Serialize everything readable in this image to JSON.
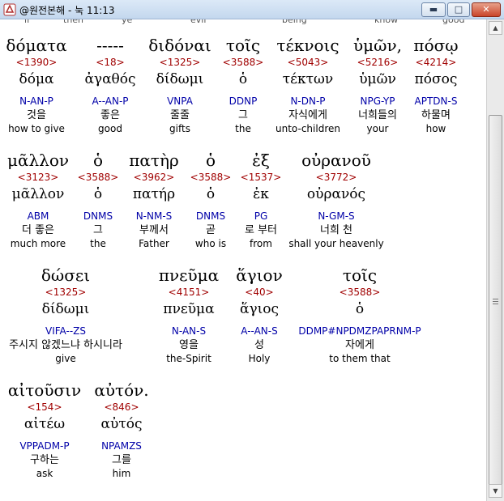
{
  "window": {
    "title": "@원전본해 - 눅 11:13"
  },
  "top_fragments": [
    "if",
    "then",
    "ye",
    "evil",
    "being",
    "know",
    "good"
  ],
  "lines": [
    [
      {
        "word": "δόματα",
        "strongs": "<1390>",
        "lemma": "δόμα",
        "parsing": "N-AN-P",
        "korean": "것을",
        "english": "how to give"
      },
      {
        "word": "-----",
        "strongs": "<18>",
        "lemma": "ἀγαθός",
        "parsing": "A--AN-P",
        "korean": "좋은",
        "english": "good"
      },
      {
        "word": "διδόναι",
        "strongs": "<1325>",
        "lemma": "δίδωμι",
        "parsing": "VNPA",
        "korean": "줄줄",
        "english": "gifts"
      },
      {
        "word": "τοῖς",
        "strongs": "<3588>",
        "lemma": "ὁ",
        "parsing": "DDNP",
        "korean": "그",
        "english": "the"
      },
      {
        "word": "τέκνοις",
        "strongs": "<5043>",
        "lemma": "τέκτων",
        "parsing": "N-DN-P",
        "korean": "자식에게",
        "english": "unto-children"
      },
      {
        "word": "ὑμῶν,",
        "strongs": "<5216>",
        "lemma": "ὑμῶν",
        "parsing": "NPG-YP",
        "korean": "너희들의",
        "english": "your"
      },
      {
        "word": "πόσῳ",
        "strongs": "<4214>",
        "lemma": "πόσος",
        "parsing": "APTDN-S",
        "korean": "하물며",
        "english": "how"
      }
    ],
    [
      {
        "word": "μᾶλλον",
        "strongs": "<3123>",
        "lemma": "μᾶλλον",
        "parsing": "ABM",
        "korean": "더 좋은",
        "english": "much more"
      },
      {
        "word": "ὁ",
        "strongs": "<3588>",
        "lemma": "ὁ",
        "parsing": "DNMS",
        "korean": "그",
        "english": "the"
      },
      {
        "word": "πατὴρ",
        "strongs": "<3962>",
        "lemma": "πατήρ",
        "parsing": "N-NM-S",
        "korean": "부께서",
        "english": "Father"
      },
      {
        "word": "ὁ",
        "strongs": "<3588>",
        "lemma": "ὁ",
        "parsing": "DNMS",
        "korean": "곧",
        "english": "who is"
      },
      {
        "word": "ἐξ",
        "strongs": "<1537>",
        "lemma": "ἐκ",
        "parsing": "PG",
        "korean": "로 부터",
        "english": "from"
      },
      {
        "word": "οὐρανοῦ",
        "strongs": "<3772>",
        "lemma": "οὐρανός",
        "parsing": "N-GM-S",
        "korean": "너희 천",
        "english": "shall your heavenly"
      }
    ],
    [
      {
        "word": "δώσει",
        "strongs": "<1325>",
        "lemma": "δίδωμι",
        "parsing": "VIFA--ZS",
        "korean": "주시지 않겠느냐 하시니라",
        "english": "give"
      },
      {
        "word": "πνεῦμα",
        "strongs": "<4151>",
        "lemma": "πνεῦμα",
        "parsing": "N-AN-S",
        "korean": "영을",
        "english": "the-Spirit"
      },
      {
        "word": "ἅγιον",
        "strongs": "<40>",
        "lemma": "ἅγιος",
        "parsing": "A--AN-S",
        "korean": "성",
        "english": "Holy"
      },
      {
        "word": "τοῖς",
        "strongs": "<3588>",
        "lemma": "ὁ",
        "parsing": "DDMP#NPDMZPAPRNM-P",
        "korean": "자에게",
        "english": "to them that"
      }
    ],
    [
      {
        "word": "αἰτοῦσιν",
        "strongs": "<154>",
        "lemma": "αἰτέω",
        "parsing": "VPPADM-P",
        "korean": "구하는",
        "english": "ask"
      },
      {
        "word": "αὐτόν.",
        "strongs": "<846>",
        "lemma": "αὐτός",
        "parsing": "NPAMZS",
        "korean": "그를",
        "english": "him"
      }
    ]
  ]
}
